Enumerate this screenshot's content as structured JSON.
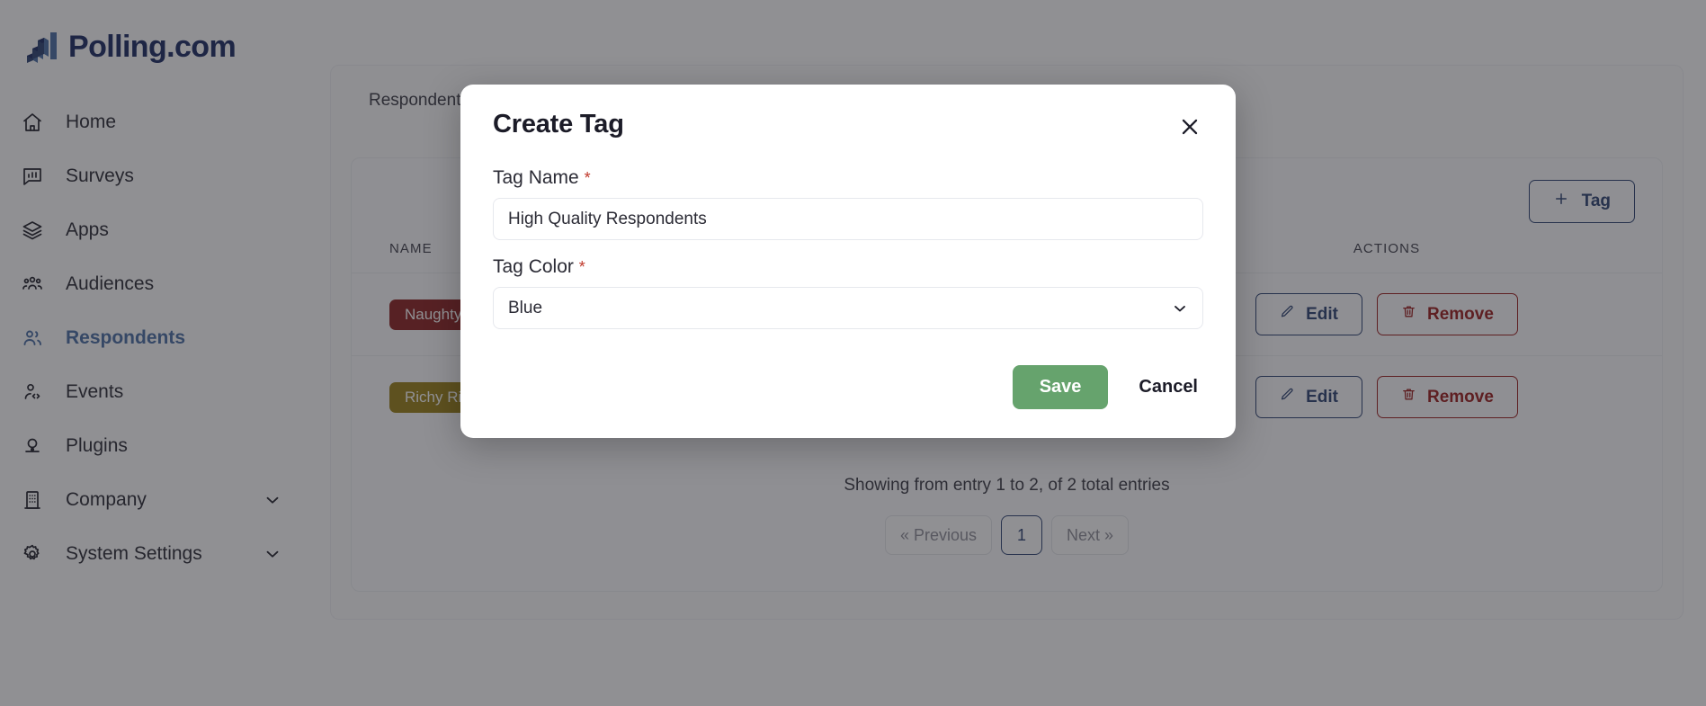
{
  "brand": {
    "name": "Polling.com",
    "logo_icon": "bar-chart-blocks-icon",
    "color": "#1b2a63"
  },
  "sidebar": {
    "items": [
      {
        "label": "Home",
        "icon": "home-icon",
        "active": false,
        "caret": false
      },
      {
        "label": "Surveys",
        "icon": "survey-icon",
        "active": false,
        "caret": false
      },
      {
        "label": "Apps",
        "icon": "layers-icon",
        "active": false,
        "caret": false
      },
      {
        "label": "Audiences",
        "icon": "users-icon",
        "active": false,
        "caret": false
      },
      {
        "label": "Respondents",
        "icon": "person-pair-icon",
        "active": true,
        "caret": false
      },
      {
        "label": "Events",
        "icon": "person-code-icon",
        "active": false,
        "caret": false
      },
      {
        "label": "Plugins",
        "icon": "plug-icon",
        "active": false,
        "caret": false
      },
      {
        "label": "Company",
        "icon": "building-icon",
        "active": false,
        "caret": true
      },
      {
        "label": "System Settings",
        "icon": "gear-icon",
        "active": false,
        "caret": true
      }
    ]
  },
  "main": {
    "breadcrumb": "Respondents",
    "toolbar": {
      "add_tag_label": "Tag",
      "add_tag_icon": "plus-icon"
    },
    "table": {
      "columns": [
        "NAME",
        "ACTIONS"
      ],
      "rows": [
        {
          "name": "Naughty List",
          "chip_color": "#8c2020",
          "edit_label": "Edit",
          "edit_icon": "pencil-icon",
          "remove_label": "Remove",
          "remove_icon": "trash-icon"
        },
        {
          "name": "Richy Rich",
          "chip_color": "#9a8017",
          "edit_label": "Edit",
          "edit_icon": "pencil-icon",
          "remove_label": "Remove",
          "remove_icon": "trash-icon"
        }
      ]
    },
    "pagination": {
      "summary": "Showing from entry 1 to 2, of 2 total entries",
      "previous_label": "« Previous",
      "next_label": "Next »",
      "current_page": "1"
    }
  },
  "modal": {
    "title": "Create Tag",
    "close_icon": "close-icon",
    "tag_name": {
      "label": "Tag Name",
      "required_marker": "*",
      "value": "High Quality Respondents",
      "placeholder": "Tag Name"
    },
    "tag_color": {
      "label": "Tag Color",
      "required_marker": "*",
      "value": "Blue",
      "caret_icon": "chevron-down-icon",
      "options": [
        "Blue"
      ]
    },
    "save_label": "Save",
    "cancel_label": "Cancel",
    "save_color": "#66a36d"
  }
}
